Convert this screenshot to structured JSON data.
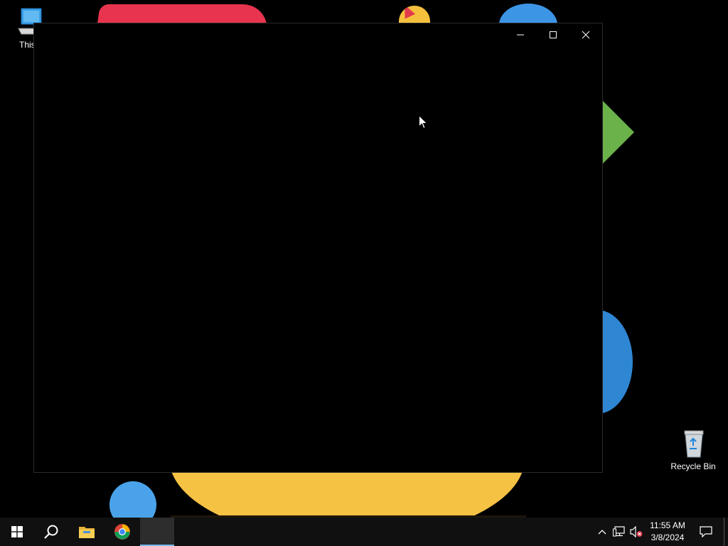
{
  "desktop": {
    "icons": [
      {
        "label": "This P",
        "icon": "this-pc-icon"
      },
      {
        "label": "Recycle Bin",
        "icon": "recycle-bin-icon"
      }
    ]
  },
  "window": {
    "title": "",
    "controls": {
      "minimize": "minimize-icon",
      "maximize": "maximize-icon",
      "close": "close-icon"
    }
  },
  "taskbar": {
    "apps": [
      {
        "name": "start",
        "icon": "windows-logo-icon"
      },
      {
        "name": "search",
        "icon": "search-icon"
      },
      {
        "name": "file-explorer",
        "icon": "folder-icon"
      },
      {
        "name": "chrome",
        "icon": "chrome-icon"
      },
      {
        "name": "active-window",
        "icon": "window-thumbnail-icon"
      }
    ],
    "tray": {
      "chevron": "chevron-up-icon",
      "network": "network-icon",
      "volume": "volume-muted-icon",
      "time": "11:55 AM",
      "date": "3/8/2024",
      "notifications": "notification-icon"
    }
  },
  "colors": {
    "accent": "#76b9ed",
    "taskbar": "#101010",
    "window_bg": "#000000"
  }
}
